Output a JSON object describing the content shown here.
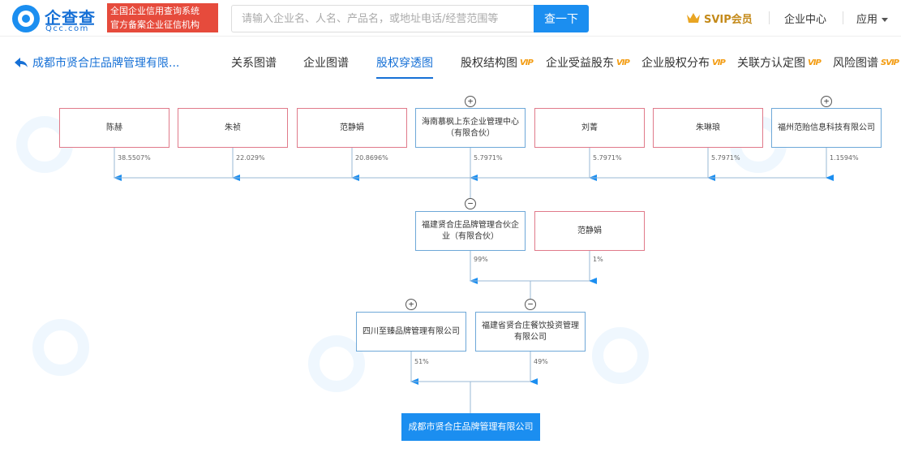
{
  "header": {
    "logo_title": "企查查",
    "logo_sub": "Qcc.com",
    "badge_line1": "全国企业信用查询系统",
    "badge_line2": "官方备案企业征信机构",
    "search_placeholder": "请输入企业名、人名、产品名，或地址电话/经营范围等",
    "search_button": "查一下",
    "svip": "SVIP会员",
    "enterprise_center": "企业中心",
    "apps": "应用"
  },
  "subnav": {
    "back_label": "成都市贤合庄品牌管理有限...",
    "tabs": [
      {
        "label": "关系图谱",
        "vip": ""
      },
      {
        "label": "企业图谱",
        "vip": ""
      },
      {
        "label": "股权穿透图",
        "vip": ""
      },
      {
        "label": "股权结构图",
        "vip": "VIP"
      },
      {
        "label": "企业受益股东",
        "vip": "VIP"
      },
      {
        "label": "企业股权分布",
        "vip": "VIP"
      },
      {
        "label": "关联方认定图",
        "vip": "VIP"
      },
      {
        "label": "风险图谱",
        "vip": "SVIP"
      }
    ]
  },
  "chart": {
    "shareholders": [
      {
        "name": "陈赫",
        "type": "person",
        "pct": "38.5507%"
      },
      {
        "name": "朱祯",
        "type": "person",
        "pct": "22.029%"
      },
      {
        "name": "范静娟",
        "type": "person",
        "pct": "20.8696%"
      },
      {
        "name": "海南慕枫上东企业管理中心（有限合伙）",
        "type": "company",
        "pct": "5.7971%",
        "toggle": "+"
      },
      {
        "name": "刘菁",
        "type": "person",
        "pct": "5.7971%"
      },
      {
        "name": "朱琳琅",
        "type": "person",
        "pct": "5.7971%"
      },
      {
        "name": "福州范贻信息科技有限公司",
        "type": "company",
        "pct": "1.1594%",
        "toggle": "+"
      }
    ],
    "level2": [
      {
        "name": "福建贤合庄品牌管理合伙企业（有限合伙）",
        "type": "company",
        "pct": "99%",
        "toggle": "−"
      },
      {
        "name": "范静娟",
        "type": "person",
        "pct": "1%"
      }
    ],
    "level3": [
      {
        "name": "四川至臻品牌管理有限公司",
        "type": "company",
        "pct": "51%",
        "toggle": "+"
      },
      {
        "name": "福建省贤合庄餐饮投资管理有限公司",
        "type": "company",
        "pct": "49%",
        "toggle": "−"
      }
    ],
    "target": "成都市贤合庄品牌管理有限公司",
    "colors": {
      "person_border": "#e07a8a",
      "company_border": "#6ea8d8",
      "line": "#9ab8d6",
      "arrow": "#1b8ef0",
      "target_fill": "#1b8ef0"
    }
  }
}
